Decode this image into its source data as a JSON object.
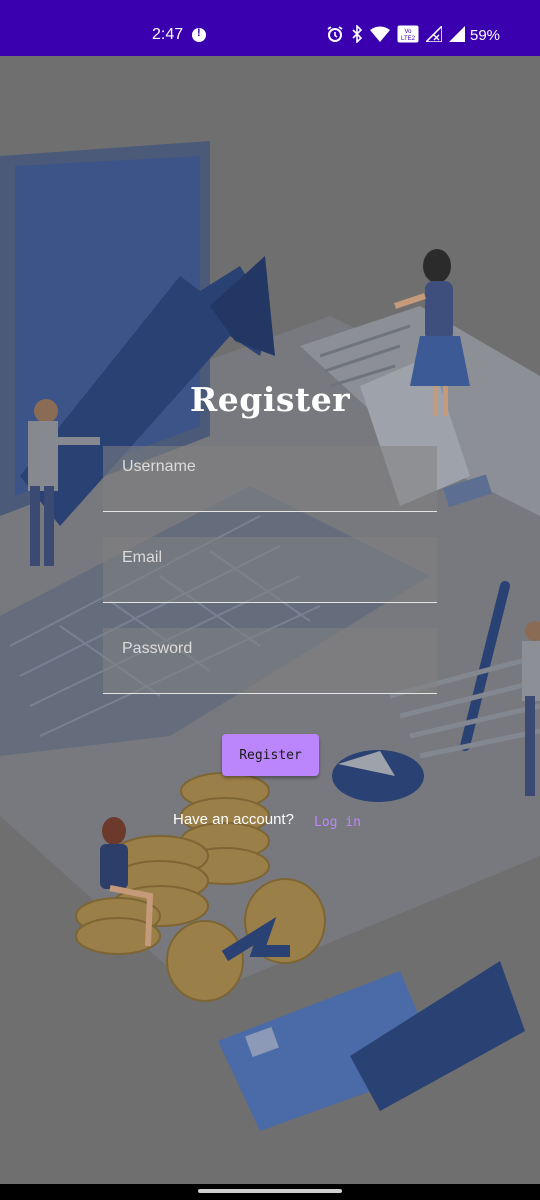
{
  "status_bar": {
    "time": "2:47",
    "battery": "59%",
    "icons": [
      "alert-icon",
      "alarm-icon",
      "bluetooth-icon",
      "wifi-icon",
      "volte-icon",
      "signal-x-icon",
      "signal-icon"
    ]
  },
  "form": {
    "title": "Register",
    "username_placeholder": "Username",
    "email_placeholder": "Email",
    "password_placeholder": "Password",
    "register_label": "Register",
    "have_account_text": "Have an account?",
    "login_label": "Log in"
  },
  "colors": {
    "status_bar": "#3a00b0",
    "accent": "#bb86fc",
    "overlay": "#6f6f6f"
  }
}
